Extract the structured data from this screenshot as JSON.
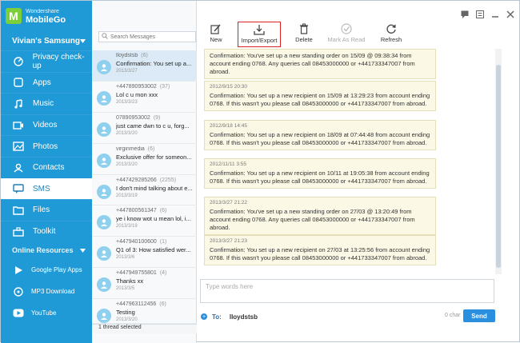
{
  "app": {
    "brand_small": "Wondershare",
    "brand_big": "MobileGo",
    "device": "Vivian's Samsung",
    "window_icons": [
      "chat-icon",
      "menu-icon",
      "minimize-icon",
      "close-icon"
    ]
  },
  "sidebar": {
    "items": [
      {
        "label": "Privacy check-up",
        "icon": "privacy-icon"
      },
      {
        "label": "Apps",
        "icon": "apps-icon"
      },
      {
        "label": "Music",
        "icon": "music-icon"
      },
      {
        "label": "Videos",
        "icon": "video-icon"
      },
      {
        "label": "Photos",
        "icon": "photo-icon"
      },
      {
        "label": "Contacts",
        "icon": "contacts-icon"
      },
      {
        "label": "SMS",
        "icon": "sms-icon",
        "active": true
      },
      {
        "label": "Files",
        "icon": "files-icon"
      },
      {
        "label": "Toolkit",
        "icon": "toolkit-icon"
      }
    ],
    "online_title": "Online Resources",
    "resources": [
      {
        "label": "Google Play Apps",
        "icon": "google-play-icon"
      },
      {
        "label": "MP3 Download",
        "icon": "mp3-icon"
      },
      {
        "label": "YouTube",
        "icon": "youtube-icon"
      }
    ]
  },
  "search": {
    "placeholder": "Search Messages"
  },
  "threads": [
    {
      "name": "lloydstsb",
      "count": "(6)",
      "snippet": "Confirmation: You set up a...",
      "date": "2013/3/27"
    },
    {
      "name": "+447890953002",
      "count": "(37)",
      "snippet": "Lol c u mon xxx",
      "date": "2013/3/23"
    },
    {
      "name": "07890953002",
      "count": "(9)",
      "snippet": "just came dwn to c u, forg...",
      "date": "2013/3/20"
    },
    {
      "name": "virginmedia",
      "count": "(6)",
      "snippet": "Exclusive offer for someon...",
      "date": "2013/3/20"
    },
    {
      "name": "+447429285266",
      "count": "(2255)",
      "snippet": "I don't mind talking about e...",
      "date": "2013/3/19"
    },
    {
      "name": "+447800561347",
      "count": "(6)",
      "snippet": "ye i know wot u mean lol, i...",
      "date": "2013/3/19"
    },
    {
      "name": "+447940100600",
      "count": "(1)",
      "snippet": "Q1 of 3: How satisfied wer...",
      "date": "2013/3/6"
    },
    {
      "name": "+447949755801",
      "count": "(4)",
      "snippet": "Thanks xx",
      "date": "2013/3/5"
    },
    {
      "name": "+447963112456",
      "count": "(6)",
      "snippet": "Testing",
      "date": "2013/3/20"
    }
  ],
  "status": "1 thread selected",
  "toolbar": {
    "new": "New",
    "import_export": "Import/Export",
    "delete": "Delete",
    "mark_read": "Mark As Read",
    "refresh": "Refresh"
  },
  "messages": [
    {
      "date": "",
      "text": "Confirmation: You've set up a new standing order on 15/09 @ 09:38:34 from account ending 0768. Any queries call 08453000000 or +441733347007 from abroad."
    },
    {
      "date": "2012/9/15 20:30",
      "text": "Confirmation: You set up a new recipient on 15/09 at 13:29:23 from account ending 0768. If this wasn't you please call 08453000000 or +441733347007 from abroad."
    },
    {
      "date": "2012/9/18 14:45",
      "text": "Confirmation: You set up a new recipient on 18/09 at 07:44:48 from account ending 0768. If this wasn't you please call 08453000000 or +441733347007 from abroad."
    },
    {
      "date": "2012/11/11 3:55",
      "text": "Confirmation: You set up a new recipient on 10/11 at 19:05:38 from account ending 0768. If this wasn't you please call 08453000000 or +441733347007 from abroad."
    },
    {
      "date": "2013/3/27 21:22",
      "text": "Confirmation: You've set up a new standing order on 27/03 @ 13:20:49 from account ending 0768. Any queries call 08453000000 or +441733347007 from abroad."
    },
    {
      "date": "2013/3/27 21:23",
      "text": "Confirmation: You set up a new recipient on 27/03 at 13:25:56 from account ending 0768. If this wasn't you please call 08453000000 or +441733347007 from abroad."
    }
  ],
  "compose": {
    "placeholder": "Type words here",
    "to_label": "To:",
    "recipient": "lloydstsb",
    "char_count": "0 char",
    "send": "Send"
  }
}
